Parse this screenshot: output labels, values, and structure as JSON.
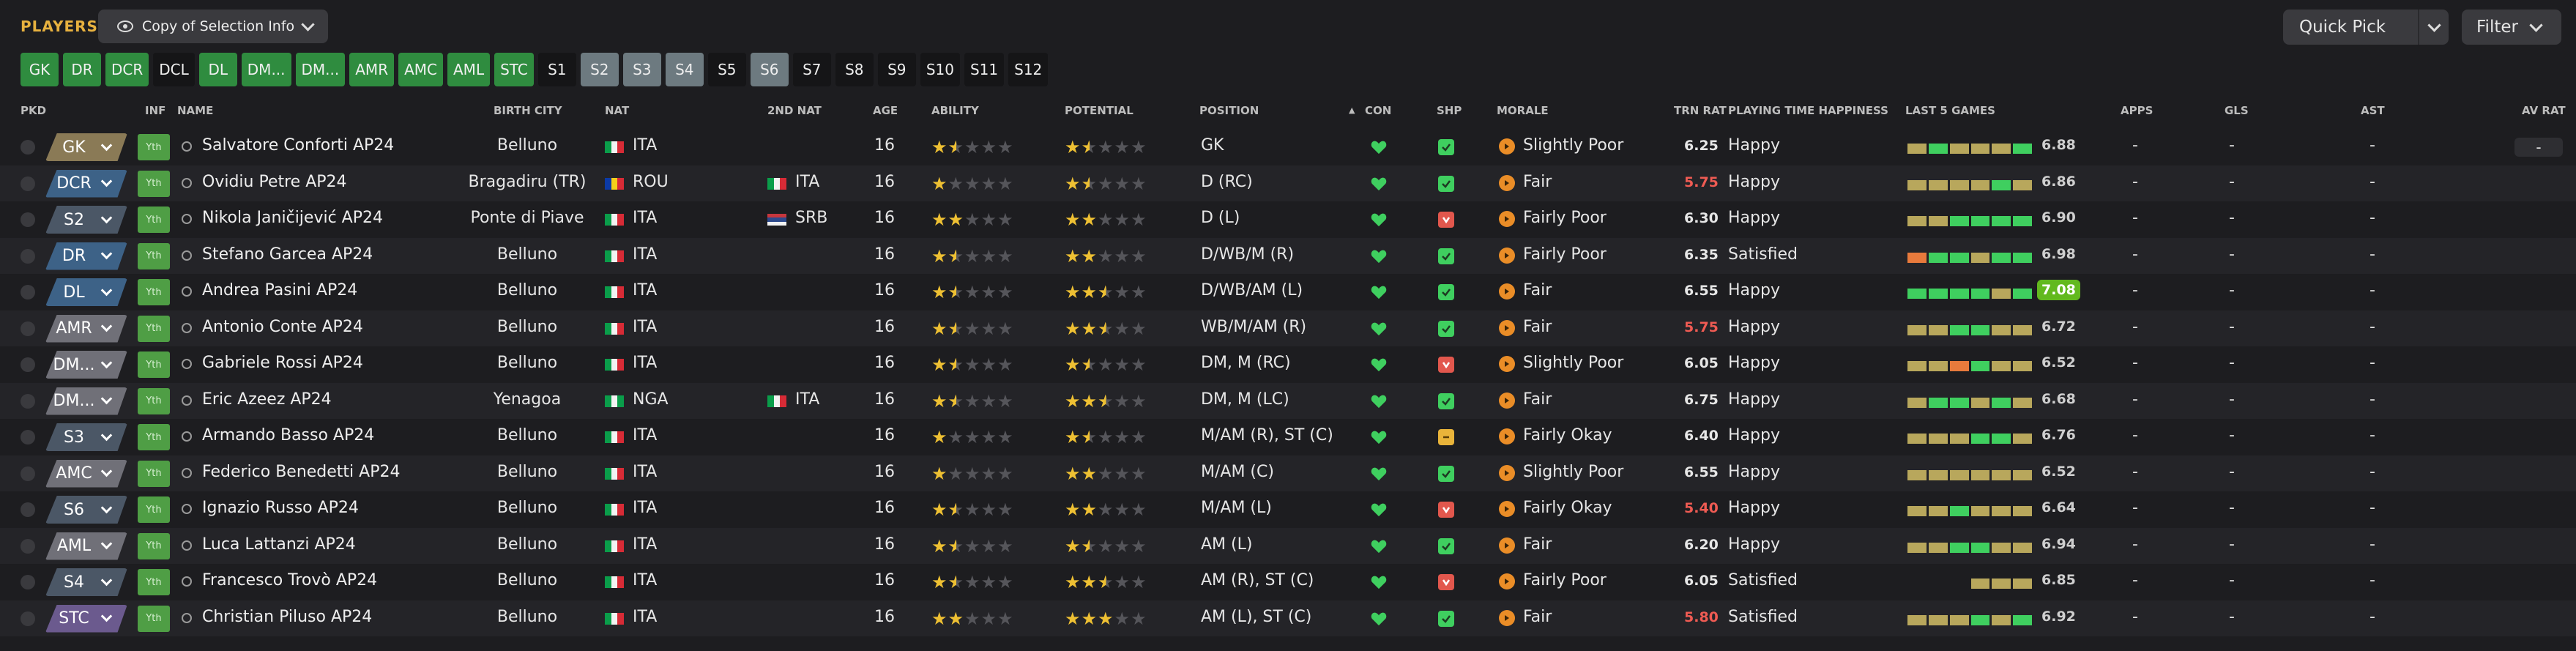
{
  "header": {
    "title": "PLAYERS",
    "copy_selection": "Copy of Selection Info",
    "quick_pick": "Quick Pick",
    "filter": "Filter"
  },
  "selection_slots": [
    {
      "label": "GK",
      "style": "green"
    },
    {
      "label": "DR",
      "style": "green"
    },
    {
      "label": "DCR",
      "style": "green"
    },
    {
      "label": "DCL",
      "style": "dark"
    },
    {
      "label": "DL",
      "style": "green"
    },
    {
      "label": "DM...",
      "style": "green"
    },
    {
      "label": "DM...",
      "style": "green"
    },
    {
      "label": "AMR",
      "style": "green"
    },
    {
      "label": "AMC",
      "style": "green"
    },
    {
      "label": "AML",
      "style": "green"
    },
    {
      "label": "STC",
      "style": "green"
    },
    {
      "label": "S1",
      "style": "dark"
    },
    {
      "label": "S2",
      "style": "gray"
    },
    {
      "label": "S3",
      "style": "gray"
    },
    {
      "label": "S4",
      "style": "gray"
    },
    {
      "label": "S5",
      "style": "dark"
    },
    {
      "label": "S6",
      "style": "gray"
    },
    {
      "label": "S7",
      "style": "dark"
    },
    {
      "label": "S8",
      "style": "dark"
    },
    {
      "label": "S9",
      "style": "dark"
    },
    {
      "label": "S10",
      "style": "dark"
    },
    {
      "label": "S11",
      "style": "dark"
    },
    {
      "label": "S12",
      "style": "dark"
    }
  ],
  "columns": {
    "pkd": "PKD",
    "inf": "INF",
    "name": "NAME",
    "birth_city": "BIRTH CITY",
    "nat": "NAT",
    "nat2": "2ND NAT",
    "age": "AGE",
    "ability": "ABILITY",
    "potential": "POTENTIAL",
    "position": "POSITION",
    "con": "CON",
    "shp": "SHP",
    "morale": "MORALE",
    "trn_rat": "TRN RAT",
    "pt_happiness": "PLAYING TIME HAPPINESS",
    "last5": "LAST 5 GAMES",
    "apps": "APPS",
    "gls": "GLS",
    "ast": "AST",
    "av_rat": "AV RAT"
  },
  "colors": {
    "accent": "#e7b13f",
    "green": "#3fcf5f",
    "red": "#ef5b53",
    "orange": "#ea8d27",
    "star": "#eec033",
    "form_high": "#3fcf5f",
    "form_mid": "#b8a75c",
    "form_low": "#e87a3c"
  },
  "players": [
    {
      "slot": "GK",
      "slot_style": "gk",
      "inf": "Yth",
      "name": "Salvatore Conforti AP24",
      "birth_city": "Belluno",
      "nat": "ITA",
      "nat2": "",
      "age": "16",
      "ability": 1.5,
      "potential": 1.5,
      "position": "GK",
      "shp": "ok",
      "morale": "Slightly Poor",
      "trn_rat": "6.25",
      "trn_red": false,
      "pt_happiness": "Happy",
      "form": [
        "mid",
        "high",
        "mid",
        "mid",
        "mid",
        "high"
      ],
      "form_avg": "6.88",
      "apps": "-",
      "gls": "-",
      "ast": "-",
      "av_rat": "-"
    },
    {
      "slot": "DCR",
      "slot_style": "def",
      "inf": "Yth",
      "name": "Ovidiu Petre AP24",
      "birth_city": "Bragadiru (TR)",
      "nat": "ROU",
      "nat2": "ITA",
      "age": "16",
      "ability": 1,
      "potential": 1.5,
      "position": "D (RC)",
      "shp": "ok",
      "morale": "Fair",
      "trn_rat": "5.75",
      "trn_red": true,
      "pt_happiness": "Happy",
      "form": [
        "mid",
        "mid",
        "mid",
        "mid",
        "high",
        "mid"
      ],
      "form_avg": "6.86",
      "apps": "-",
      "gls": "-",
      "ast": "-",
      "av_rat": "-"
    },
    {
      "slot": "S2",
      "slot_style": "sub",
      "inf": "Yth",
      "name": "Nikola Janičijević AP24",
      "birth_city": "Ponte di Piave",
      "nat": "ITA",
      "nat2": "SRB",
      "age": "16",
      "ability": 2,
      "potential": 2,
      "position": "D (L)",
      "shp": "bad",
      "morale": "Fairly Poor",
      "trn_rat": "6.30",
      "trn_red": false,
      "pt_happiness": "Happy",
      "form": [
        "mid",
        "mid",
        "high",
        "high",
        "high",
        "high"
      ],
      "form_avg": "6.90",
      "apps": "-",
      "gls": "-",
      "ast": "-",
      "av_rat": "-"
    },
    {
      "slot": "DR",
      "slot_style": "def",
      "inf": "Yth",
      "name": "Stefano Garcea AP24",
      "birth_city": "Belluno",
      "nat": "ITA",
      "nat2": "",
      "age": "16",
      "ability": 1.5,
      "potential": 2,
      "position": "D/WB/M (R)",
      "shp": "ok",
      "morale": "Fairly Poor",
      "trn_rat": "6.35",
      "trn_red": false,
      "pt_happiness": "Satisfied",
      "form": [
        "low",
        "high",
        "high",
        "mid",
        "high",
        "high"
      ],
      "form_avg": "6.98",
      "apps": "-",
      "gls": "-",
      "ast": "-",
      "av_rat": "-"
    },
    {
      "slot": "DL",
      "slot_style": "def",
      "inf": "Yth",
      "name": "Andrea Pasini AP24",
      "birth_city": "Belluno",
      "nat": "ITA",
      "nat2": "",
      "age": "16",
      "ability": 1.5,
      "potential": 2.5,
      "position": "D/WB/AM (L)",
      "shp": "ok",
      "morale": "Fair",
      "trn_rat": "6.55",
      "trn_red": false,
      "pt_happiness": "Happy",
      "form": [
        "high",
        "high",
        "high",
        "high",
        "mid",
        "high"
      ],
      "form_avg": "7.08",
      "form_best": true,
      "apps": "-",
      "gls": "-",
      "ast": "-",
      "av_rat": "-"
    },
    {
      "slot": "AMR",
      "slot_style": "mid",
      "inf": "Yth",
      "name": "Antonio Conte AP24",
      "birth_city": "Belluno",
      "nat": "ITA",
      "nat2": "",
      "age": "16",
      "ability": 1.5,
      "potential": 2.5,
      "position": "WB/M/AM (R)",
      "shp": "ok",
      "morale": "Fair",
      "trn_rat": "5.75",
      "trn_red": true,
      "pt_happiness": "Happy",
      "form": [
        "mid",
        "mid",
        "high",
        "high",
        "mid",
        "mid"
      ],
      "form_avg": "6.72",
      "apps": "-",
      "gls": "-",
      "ast": "-",
      "av_rat": "-"
    },
    {
      "slot": "DM...",
      "slot_style": "mid",
      "inf": "Yth",
      "name": "Gabriele Rossi AP24",
      "birth_city": "Belluno",
      "nat": "ITA",
      "nat2": "",
      "age": "16",
      "ability": 1.5,
      "potential": 1.5,
      "position": "DM, M (RC)",
      "shp": "bad",
      "morale": "Slightly Poor",
      "trn_rat": "6.05",
      "trn_red": false,
      "pt_happiness": "Happy",
      "form": [
        "mid",
        "mid",
        "low",
        "high",
        "mid",
        "mid"
      ],
      "form_avg": "6.52",
      "apps": "-",
      "gls": "-",
      "ast": "-",
      "av_rat": "-"
    },
    {
      "slot": "DM...",
      "slot_style": "mid",
      "inf": "Yth",
      "name": "Eric Azeez AP24",
      "birth_city": "Yenagoa",
      "nat": "NGA",
      "nat2": "ITA",
      "age": "16",
      "ability": 1.5,
      "potential": 2.5,
      "position": "DM, M (LC)",
      "shp": "ok",
      "morale": "Fair",
      "trn_rat": "6.75",
      "trn_red": false,
      "pt_happiness": "Happy",
      "form": [
        "mid",
        "high",
        "high",
        "mid",
        "high",
        "mid"
      ],
      "form_avg": "6.68",
      "apps": "-",
      "gls": "-",
      "ast": "-",
      "av_rat": "-"
    },
    {
      "slot": "S3",
      "slot_style": "sub",
      "inf": "Yth",
      "name": "Armando Basso AP24",
      "birth_city": "Belluno",
      "nat": "ITA",
      "nat2": "",
      "age": "16",
      "ability": 1,
      "potential": 1.5,
      "position": "M/AM (R), ST (C)",
      "shp": "mid",
      "morale": "Fairly Okay",
      "trn_rat": "6.40",
      "trn_red": false,
      "pt_happiness": "Happy",
      "form": [
        "mid",
        "mid",
        "mid",
        "high",
        "high",
        "mid"
      ],
      "form_avg": "6.76",
      "apps": "-",
      "gls": "-",
      "ast": "-",
      "av_rat": "-"
    },
    {
      "slot": "AMC",
      "slot_style": "mid",
      "inf": "Yth",
      "name": "Federico Benedetti AP24",
      "birth_city": "Belluno",
      "nat": "ITA",
      "nat2": "",
      "age": "16",
      "ability": 1,
      "potential": 2,
      "position": "M/AM (C)",
      "shp": "ok",
      "morale": "Slightly Poor",
      "trn_rat": "6.55",
      "trn_red": false,
      "pt_happiness": "Happy",
      "form": [
        "mid",
        "mid",
        "mid",
        "mid",
        "mid",
        "mid"
      ],
      "form_avg": "6.52",
      "apps": "-",
      "gls": "-",
      "ast": "-",
      "av_rat": "-"
    },
    {
      "slot": "S6",
      "slot_style": "sub",
      "inf": "Yth",
      "name": "Ignazio Russo AP24",
      "birth_city": "Belluno",
      "nat": "ITA",
      "nat2": "",
      "age": "16",
      "ability": 1.5,
      "potential": 2,
      "position": "M/AM (L)",
      "shp": "bad",
      "morale": "Fairly Okay",
      "trn_rat": "5.40",
      "trn_red": true,
      "pt_happiness": "Happy",
      "form": [
        "mid",
        "mid",
        "high",
        "mid",
        "mid",
        "mid"
      ],
      "form_avg": "6.64",
      "apps": "-",
      "gls": "-",
      "ast": "-",
      "av_rat": "-"
    },
    {
      "slot": "AML",
      "slot_style": "mid",
      "inf": "Yth",
      "name": "Luca Lattanzi AP24",
      "birth_city": "Belluno",
      "nat": "ITA",
      "nat2": "",
      "age": "16",
      "ability": 1.5,
      "potential": 1.5,
      "position": "AM (L)",
      "shp": "ok",
      "morale": "Fair",
      "trn_rat": "6.20",
      "trn_red": false,
      "pt_happiness": "Happy",
      "form": [
        "mid",
        "mid",
        "high",
        "high",
        "mid",
        "mid"
      ],
      "form_avg": "6.94",
      "apps": "-",
      "gls": "-",
      "ast": "-",
      "av_rat": "-"
    },
    {
      "slot": "S4",
      "slot_style": "sub",
      "inf": "Yth",
      "name": "Francesco Trovò AP24",
      "birth_city": "Belluno",
      "nat": "ITA",
      "nat2": "",
      "age": "16",
      "ability": 1.5,
      "potential": 2.5,
      "position": "AM (R), ST (C)",
      "shp": "bad",
      "morale": "Fairly Poor",
      "trn_rat": "6.05",
      "trn_red": false,
      "pt_happiness": "Satisfied",
      "form": [
        "none",
        "none",
        "none",
        "mid",
        "mid",
        "mid"
      ],
      "form_avg": "6.85",
      "apps": "-",
      "gls": "-",
      "ast": "-",
      "av_rat": "-"
    },
    {
      "slot": "STC",
      "slot_style": "str",
      "inf": "Yth",
      "name": "Christian Piluso AP24",
      "birth_city": "Belluno",
      "nat": "ITA",
      "nat2": "",
      "age": "16",
      "ability": 2,
      "potential": 3,
      "position": "AM (L), ST (C)",
      "shp": "ok",
      "morale": "Fair",
      "trn_rat": "5.80",
      "trn_red": true,
      "pt_happiness": "Satisfied",
      "form": [
        "mid",
        "mid",
        "mid",
        "high",
        "mid",
        "high"
      ],
      "form_avg": "6.92",
      "apps": "-",
      "gls": "-",
      "ast": "-",
      "av_rat": "-"
    }
  ]
}
